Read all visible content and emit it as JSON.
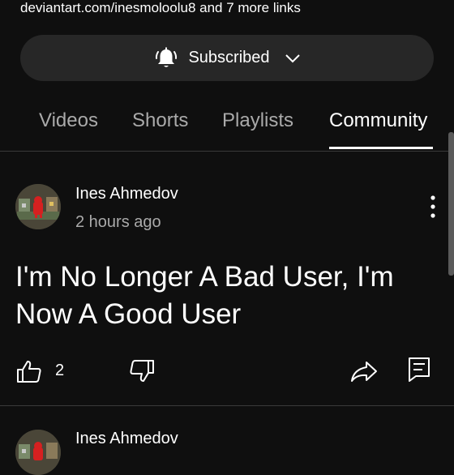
{
  "header": {
    "links_text": "deviantart.com/inesmoloolu8 and 7 more links",
    "subscribe_label": "Subscribed"
  },
  "tabs": [
    {
      "label": "Videos",
      "active": false
    },
    {
      "label": "Shorts",
      "active": false
    },
    {
      "label": "Playlists",
      "active": false
    },
    {
      "label": "Community",
      "active": true
    }
  ],
  "posts": [
    {
      "author": "Ines Ahmedov",
      "time": "2 hours ago",
      "text": "I'm No Longer A Bad User, I'm Now A Good User",
      "likes": "2",
      "icons": [
        "like-icon",
        "dislike-icon",
        "share-icon",
        "comment-icon",
        "more-options-icon"
      ]
    },
    {
      "author": "Ines Ahmedov"
    }
  ],
  "colors": {
    "background": "#0f0f0f",
    "button": "#272727",
    "text_primary": "#ffffff",
    "text_secondary": "#aaaaaa"
  }
}
